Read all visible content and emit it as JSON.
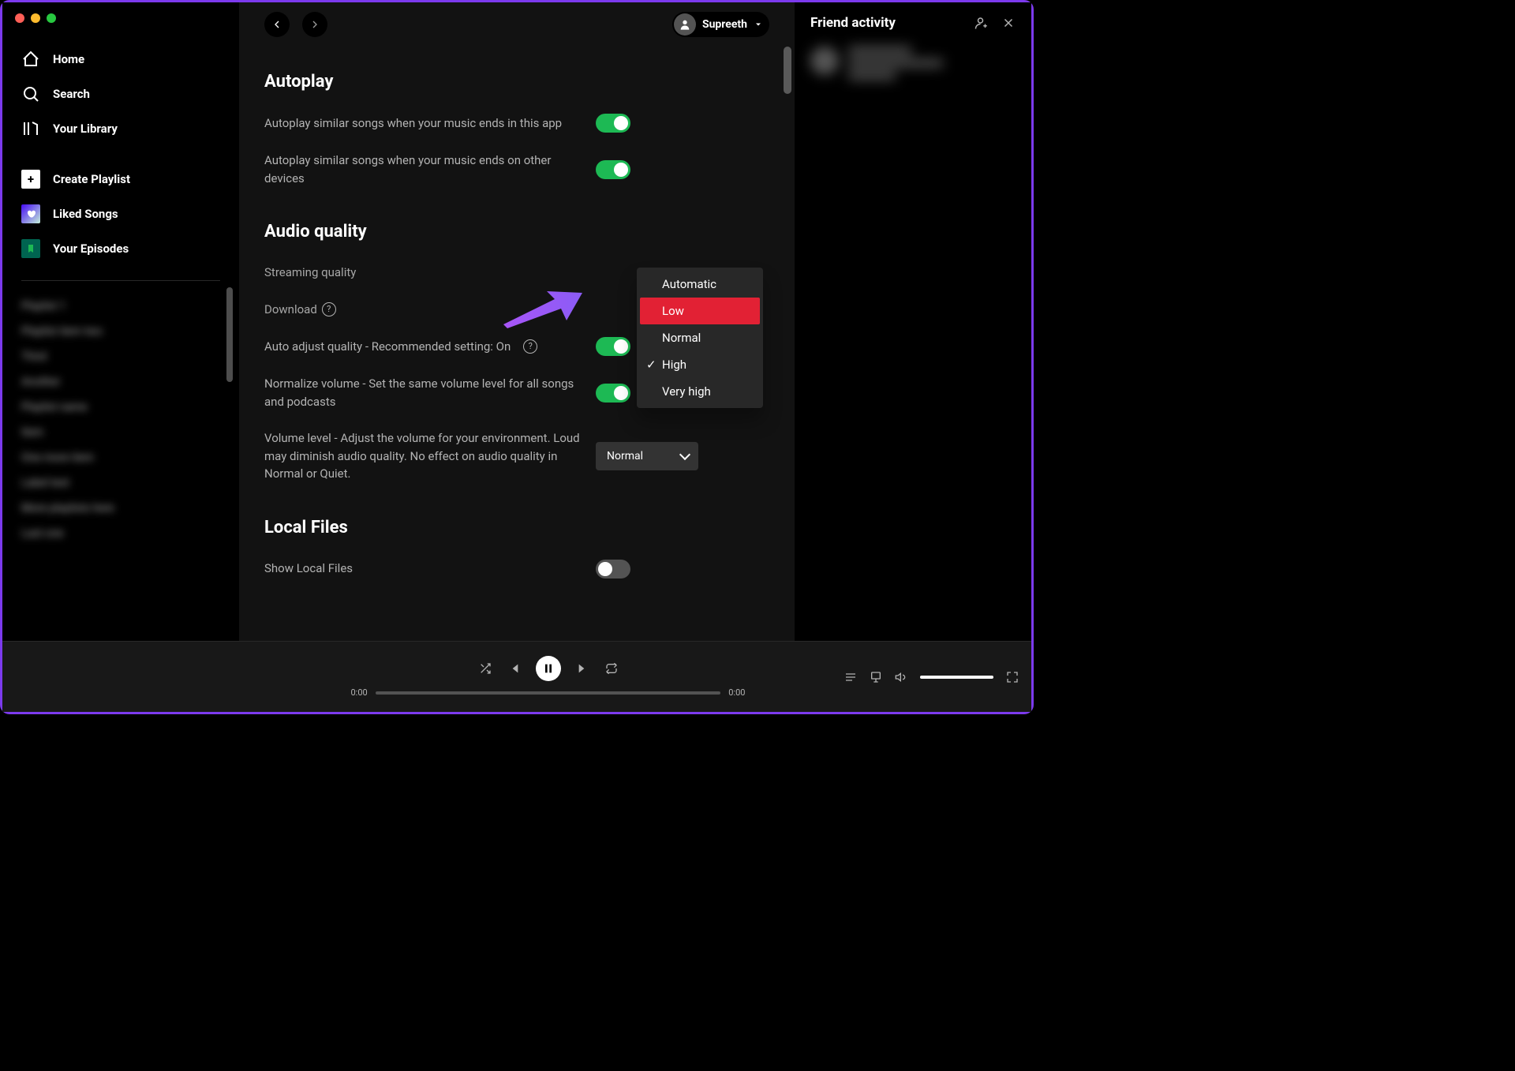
{
  "sidebar": {
    "home": "Home",
    "search": "Search",
    "library": "Your Library",
    "create_playlist": "Create Playlist",
    "liked_songs": "Liked Songs",
    "your_episodes": "Your Episodes",
    "playlists": [
      "Playlist 1",
      "Playlist item two",
      "Third",
      "Another",
      "Playlist name",
      "Item",
      "One more item",
      "Label text",
      "More playlists here",
      "Last one"
    ]
  },
  "topbar": {
    "user_name": "Supreeth"
  },
  "settings": {
    "autoplay": {
      "title": "Autoplay",
      "similar_app": "Autoplay similar songs when your music ends in this app",
      "similar_devices": "Autoplay similar songs when your music ends on other devices"
    },
    "audio_quality": {
      "title": "Audio quality",
      "streaming_label": "Streaming quality",
      "download_label": "Download",
      "auto_adjust": "Auto adjust quality - Recommended setting: On",
      "normalize": "Normalize volume - Set the same volume level for all songs and podcasts",
      "volume_level": "Volume level - Adjust the volume for your environment. Loud may diminish audio quality. No effect on audio quality in Normal or Quiet.",
      "volume_selected": "Normal"
    },
    "local_files": {
      "title": "Local Files",
      "show_label": "Show Local Files"
    },
    "dropdown": {
      "options": [
        "Automatic",
        "Low",
        "Normal",
        "High",
        "Very high"
      ],
      "highlighted": "Low",
      "selected": "High"
    }
  },
  "friend_panel": {
    "title": "Friend activity"
  },
  "player": {
    "time_current": "0:00",
    "time_total": "0:00"
  }
}
